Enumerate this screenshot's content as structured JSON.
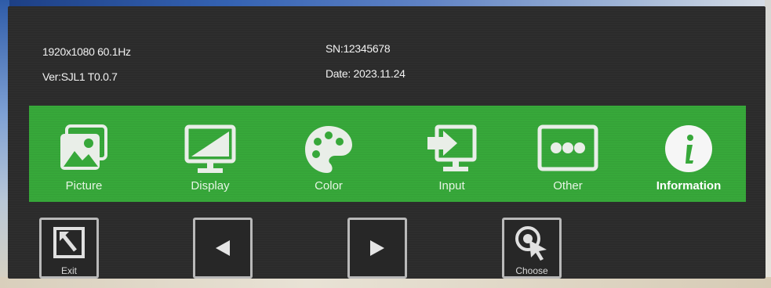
{
  "info": {
    "resolution": "1920x1080 60.1Hz",
    "version": "Ver:SJL1 T0.0.7",
    "serial": "SN:12345678",
    "date": "Date: 2023.11.24"
  },
  "menu": {
    "items": [
      {
        "label": "Picture",
        "icon": "picture-icon"
      },
      {
        "label": "Display",
        "icon": "display-icon"
      },
      {
        "label": "Color",
        "icon": "palette-icon"
      },
      {
        "label": "Input",
        "icon": "input-icon"
      },
      {
        "label": "Other",
        "icon": "other-icon"
      },
      {
        "label": "Information",
        "icon": "info-icon"
      }
    ],
    "active": "Information"
  },
  "buttons": {
    "exit_label": "Exit",
    "left_icon": "left-arrow-icon",
    "right_icon": "right-arrow-icon",
    "choose_label": "Choose"
  },
  "colors": {
    "menu_bar": "#37a83a",
    "osd_background": "#2b2b2b",
    "icon": "#e9eee8"
  }
}
